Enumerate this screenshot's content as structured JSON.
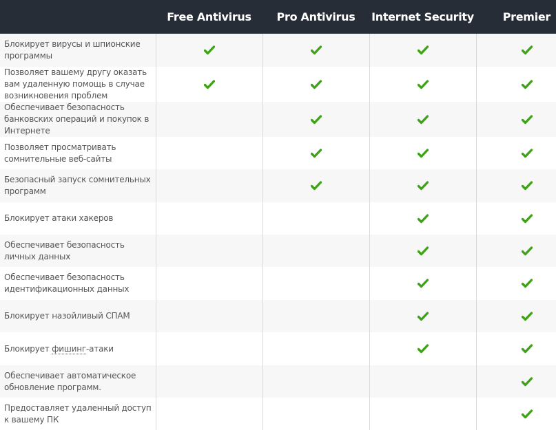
{
  "header": {
    "feature_column": "",
    "plans": [
      "Free Antivirus",
      "Pro Antivirus",
      "Internet Security",
      "Premier"
    ]
  },
  "colors": {
    "header_bg": "#262d36",
    "check": "#3fa318",
    "row_alt": "#f7f7f7",
    "text": "#555555"
  },
  "rows": [
    {
      "feature": "Блокирует вирусы и шпионские программы",
      "has": [
        true,
        true,
        true,
        true
      ],
      "h": 48
    },
    {
      "feature": "Позволяет вашему другу оказать вам удаленную помощь в случае возникновения проблем",
      "has": [
        true,
        true,
        true,
        true
      ],
      "h": 51
    },
    {
      "feature": "Обеспечивает безопасность банковских операций и покупок в Интернете",
      "has": [
        false,
        true,
        true,
        true
      ],
      "h": 51
    },
    {
      "feature": "Позволяет просматривать сомнительные веб-сайты",
      "has": [
        false,
        true,
        true,
        true
      ],
      "h": 47
    },
    {
      "feature": "Безопасный запуск сомнительных программ",
      "has": [
        false,
        true,
        true,
        true
      ],
      "h": 48
    },
    {
      "feature": "Блокирует атаки хакеров",
      "has": [
        false,
        false,
        true,
        true
      ],
      "h": 47
    },
    {
      "feature": "Обеспечивает безопасность личных данных",
      "has": [
        false,
        false,
        true,
        true
      ],
      "h": 47
    },
    {
      "feature": "Обеспечивает безопасность идентификационных данных",
      "has": [
        false,
        false,
        true,
        true
      ],
      "h": 48
    },
    {
      "feature": "Блокирует назойливый СПАМ",
      "has": [
        false,
        false,
        true,
        true
      ],
      "h": 47
    },
    {
      "feature_prefix": "Блокирует ",
      "feature_term": "фишинг",
      "feature_suffix": "-атаки",
      "feature": "Блокирует фишинг-атаки",
      "has": [
        false,
        false,
        true,
        true
      ],
      "h": 48
    },
    {
      "feature": "Обеспечивает автоматическое обновление программ.",
      "has": [
        false,
        false,
        false,
        true
      ],
      "h": 47
    },
    {
      "feature": "Предоставляет удаленный доступ к вашему ПК",
      "has": [
        false,
        false,
        false,
        true
      ],
      "h": 47
    }
  ]
}
